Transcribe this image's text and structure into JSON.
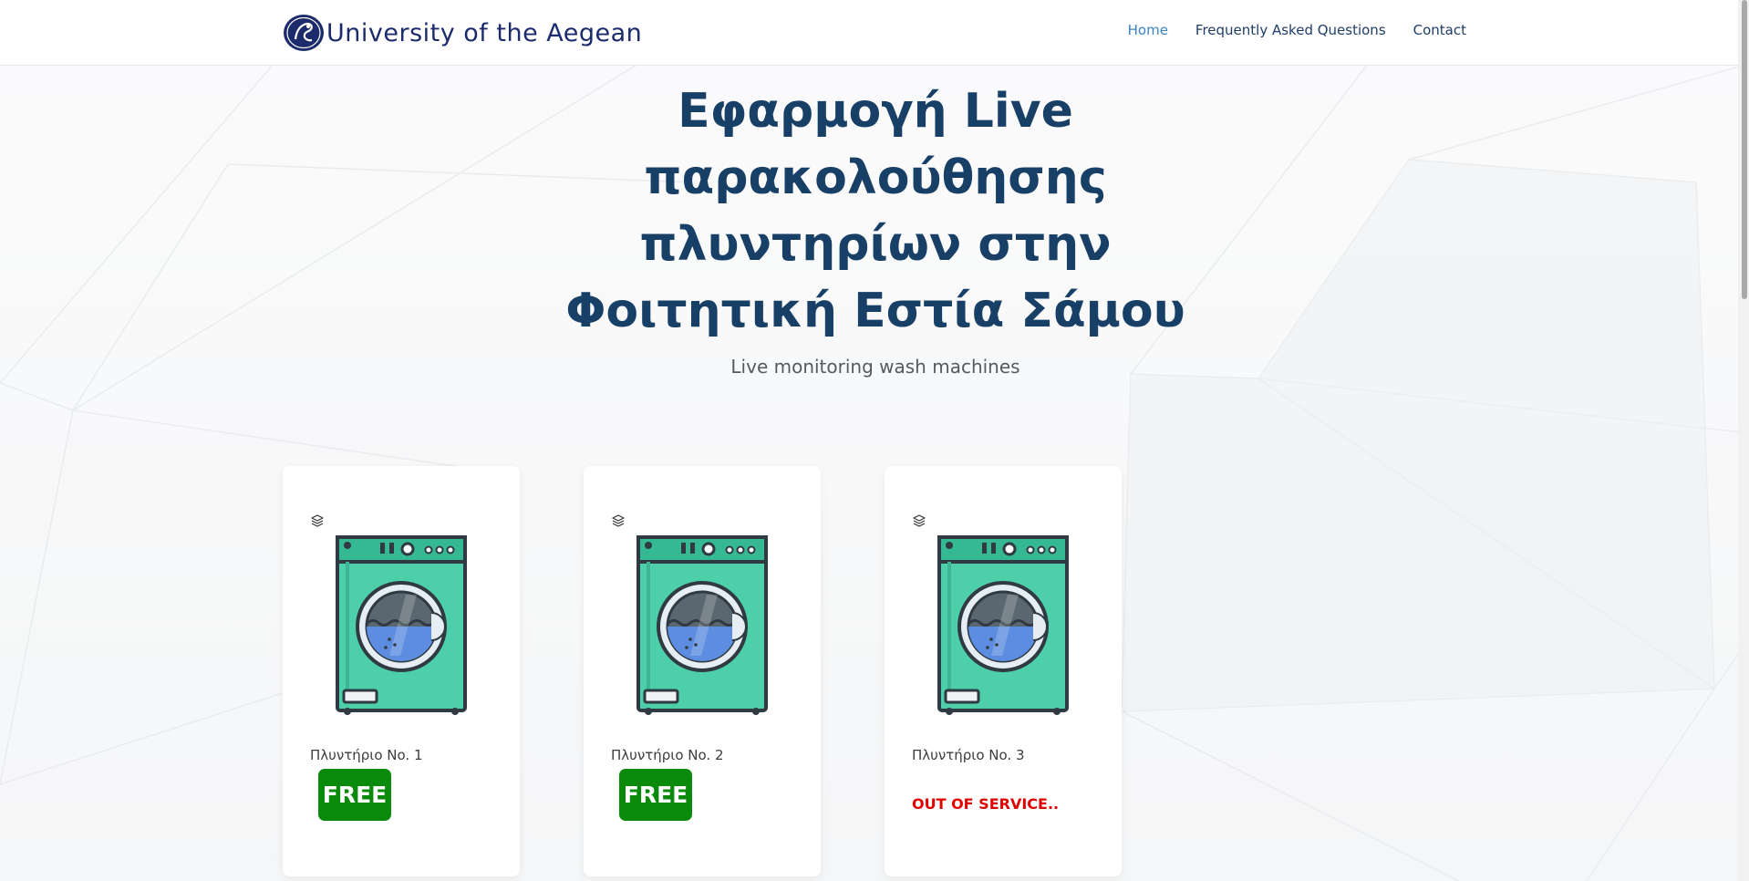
{
  "brand": {
    "name": "University of the Aegean"
  },
  "nav": {
    "items": [
      {
        "label": "Home",
        "active": true
      },
      {
        "label": "Frequently Asked Questions",
        "active": false
      },
      {
        "label": "Contact",
        "active": false
      }
    ]
  },
  "hero": {
    "title": "Εφαρμογή Live παρακολούθησης πλυντηρίων στην Φοιτητική Εστία Σάμου",
    "subtitle": "Live monitoring wash machines"
  },
  "machines": [
    {
      "label": "Πλυντήριο No. 1",
      "status": "FREE"
    },
    {
      "label": "Πλυντήριο No. 2",
      "status": "FREE"
    },
    {
      "label": "Πλυντήριο No. 3",
      "status": "OUT OF SERVICE.."
    }
  ],
  "colors": {
    "brand": "#1c2b6b",
    "heading": "#183f66",
    "nav_active": "#3a83c4",
    "free_badge": "#0a8a0a",
    "out_of_service": "#e00000",
    "machine_body": "#4dcfa9"
  },
  "icons": {
    "card_icon": "layers-icon",
    "machine_image": "washing-machine-icon",
    "brand_logo": "university-logo"
  }
}
